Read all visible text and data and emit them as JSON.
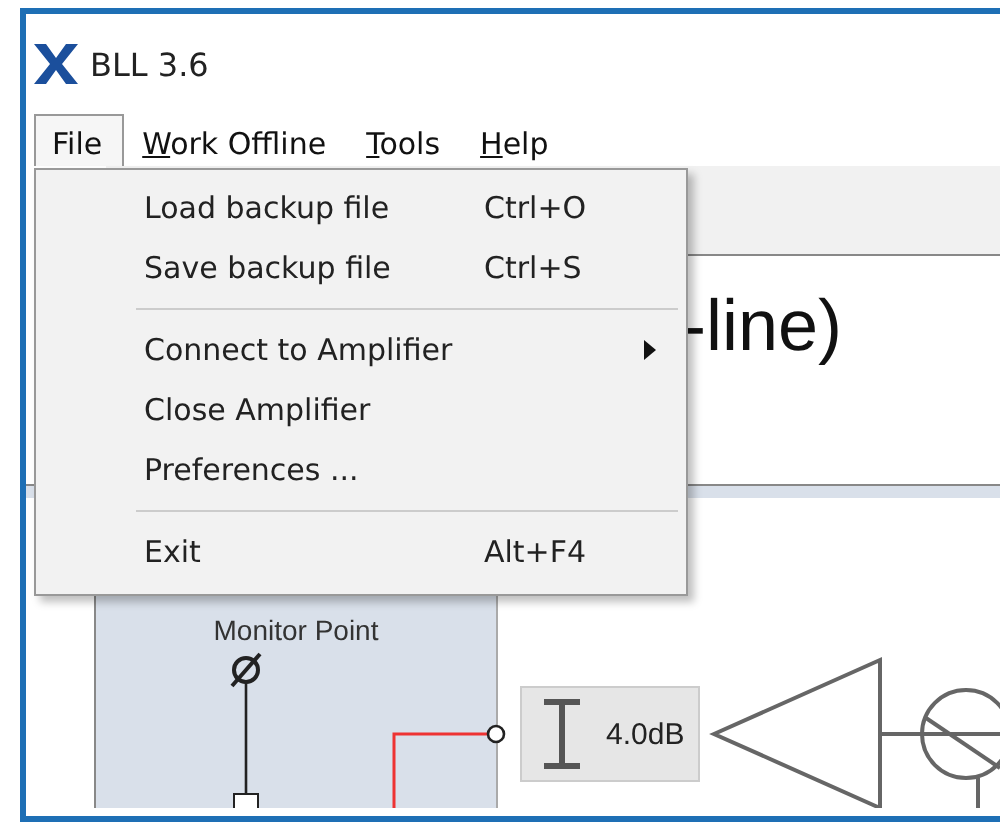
{
  "window": {
    "title": "BLL 3.6"
  },
  "menu_bar": [
    {
      "label": "File",
      "selected": true,
      "mnemonic": false
    },
    {
      "label": "Work Offline",
      "selected": false,
      "mnemonic": true
    },
    {
      "label": "Tools",
      "selected": false,
      "mnemonic": true
    },
    {
      "label": "Help",
      "selected": false,
      "mnemonic": true
    }
  ],
  "heading": "-line)",
  "file_menu": [
    {
      "kind": "item",
      "label": "Load backup file",
      "shortcut": "Ctrl+O"
    },
    {
      "kind": "item",
      "label": "Save backup file",
      "shortcut": "Ctrl+S"
    },
    {
      "kind": "separator"
    },
    {
      "kind": "submenu",
      "label": "Connect to Amplifier"
    },
    {
      "kind": "item",
      "label": "Close Amplifier"
    },
    {
      "kind": "item",
      "label": "Preferences ..."
    },
    {
      "kind": "separator"
    },
    {
      "kind": "item",
      "label": "Exit",
      "shortcut": "Alt+F4"
    }
  ],
  "monitor_panel": {
    "title": "Monitor Point"
  },
  "gain_block": {
    "value": "4.0dB"
  }
}
